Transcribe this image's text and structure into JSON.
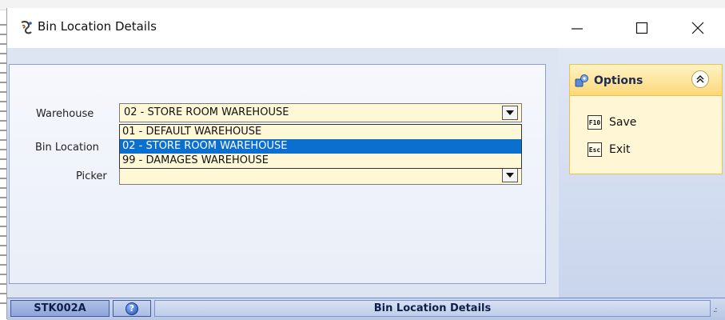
{
  "window": {
    "title": "Bin Location Details",
    "controls": {
      "minimize": "minimize",
      "maximize": "maximize",
      "close": "close"
    }
  },
  "form": {
    "warehouse_label": "Warehouse",
    "warehouse_value": "02 - STORE ROOM WAREHOUSE",
    "bin_location_label": "Bin Location",
    "picker_label": "Picker",
    "picker_value": "",
    "dropdown_options": [
      {
        "label": "01 - DEFAULT WAREHOUSE",
        "selected": false
      },
      {
        "label": "02 - STORE ROOM WAREHOUSE",
        "selected": true
      },
      {
        "label": "99 - DAMAGES WAREHOUSE",
        "selected": false
      }
    ]
  },
  "options_panel": {
    "title": "Options",
    "items": [
      {
        "key": "F10",
        "label": "Save",
        "icon": "f10-key-icon"
      },
      {
        "key": "Esc",
        "label": "Exit",
        "icon": "esc-key-icon"
      }
    ]
  },
  "statusbar": {
    "code": "STK002A",
    "title": "Bin Location Details",
    "help_icon": "help-icon"
  },
  "colors": {
    "field_background": "#fff8d6",
    "selection": "#0b6fd0",
    "client_background": "#dde5f3",
    "options_header": "#fbd879"
  }
}
